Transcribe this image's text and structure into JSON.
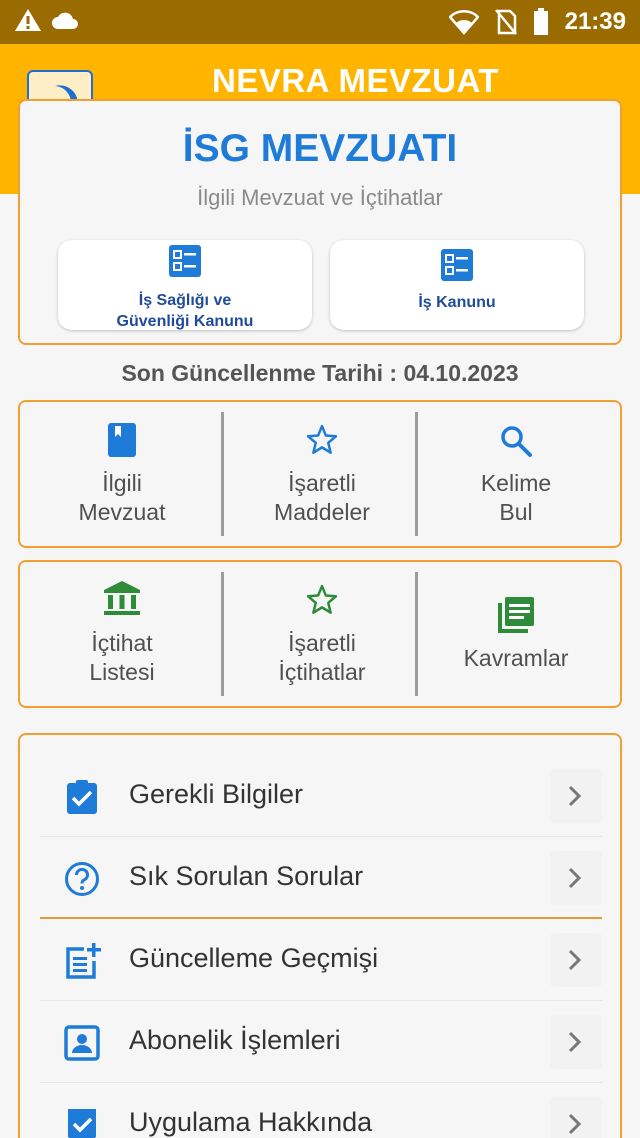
{
  "status_bar": {
    "time": "21:39"
  },
  "header": {
    "app_title": "NEVRA MEVZUAT"
  },
  "hero": {
    "title": "İSG MEVZUATI",
    "subtitle": "İlgili Mevzuat ve İçtihatlar",
    "buttons": [
      {
        "label_line1": "İş Sağlığı ve",
        "label_line2": "Güvenliği Kanunu",
        "icon": "list-icon"
      },
      {
        "label": "İş Kanunu",
        "icon": "list-icon"
      }
    ]
  },
  "update": {
    "text": "Son Güncellenme Tarihi : 04.10.2023"
  },
  "grid1": [
    {
      "line1": "İlgili",
      "line2": "Mevzuat",
      "icon": "book-icon"
    },
    {
      "line1": "İşaretli",
      "line2": "Maddeler",
      "icon": "star-icon"
    },
    {
      "line1": "Kelime",
      "line2": "Bul",
      "icon": "search-icon"
    }
  ],
  "grid2": [
    {
      "line1": "İçtihat",
      "line2": "Listesi",
      "icon": "bank-icon"
    },
    {
      "line1": "İşaretli",
      "line2": "İçtihatlar",
      "icon": "star-icon"
    },
    {
      "line1": "Kavramlar",
      "icon": "library-books-icon"
    }
  ],
  "menu": [
    {
      "label": "Gerekli Bilgiler",
      "icon": "clipboard-check-icon"
    },
    {
      "label": "Sık Sorulan Sorular",
      "icon": "help-circle-icon"
    },
    {
      "label": "Güncelleme Geçmişi",
      "icon": "post-add-icon"
    },
    {
      "label": "Abonelik İşlemleri",
      "icon": "account-box-icon"
    },
    {
      "label": "Uygulama Hakkında",
      "icon": "verified-icon"
    }
  ],
  "colors": {
    "primary": "#ffb400",
    "status_bar": "#9a6b00",
    "accent_blue": "#1e7bd7",
    "green": "#2e8b3a",
    "card_border": "#f0a030"
  }
}
